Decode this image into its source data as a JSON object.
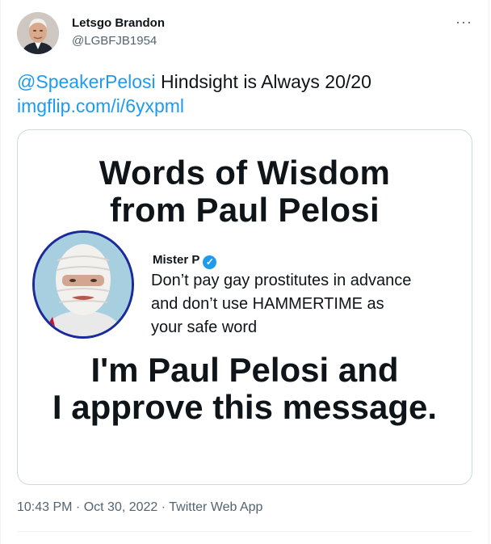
{
  "author": {
    "display_name": "Letsgo Brandon",
    "handle": "@LGBFJB1954"
  },
  "more_icon": "ellipsis-icon",
  "tweet": {
    "mention": "@SpeakerPelosi",
    "text": " Hindsight is Always 20/20",
    "link": "imgflip.com/i/6yxpml"
  },
  "meme": {
    "title_line1": "Words of Wisdom",
    "title_line2": "from Paul Pelosi",
    "quote_author": "Mister P",
    "quote_line1": "Don’t pay gay prostitutes in advance",
    "quote_line2": "and don’t use HAMMERTIME as",
    "quote_line3": "your safe word",
    "bottom_line1": "I'm Paul Pelosi and",
    "bottom_line2": "I approve this message."
  },
  "meta": {
    "timestamp": "10:43 PM · Oct 30, 2022 · Twitter Web App"
  },
  "colors": {
    "link": "#1d9bf0",
    "secondary_text": "#536471",
    "border": "#cfd9de"
  }
}
